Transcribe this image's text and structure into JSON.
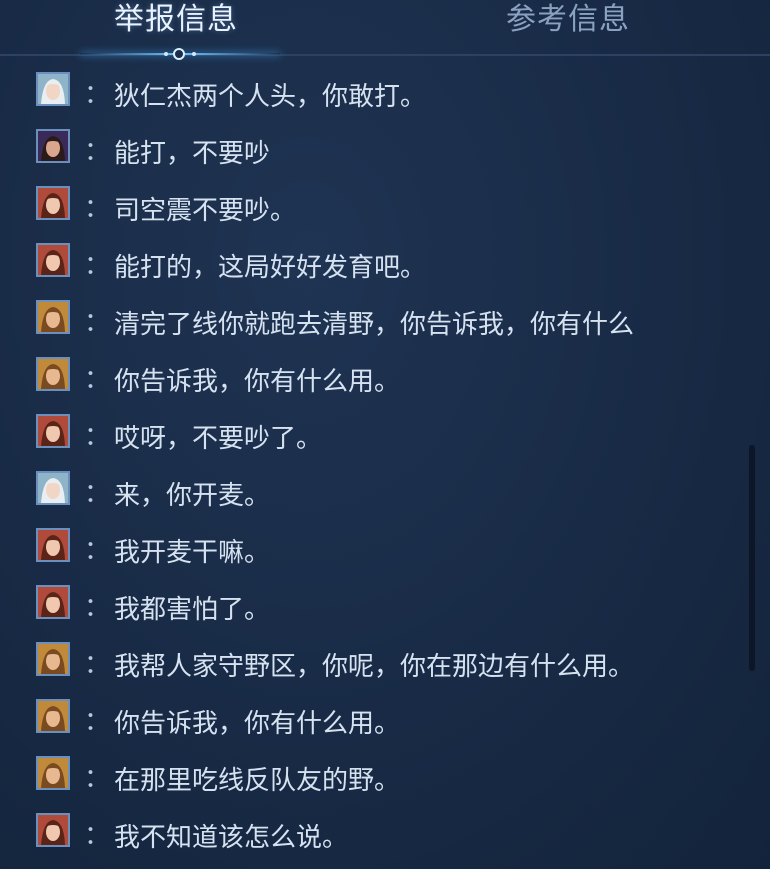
{
  "tabs": {
    "active_label": "举报信息",
    "inactive_label": "参考信息"
  },
  "messages": [
    {
      "avatar": "hero-a-avatar",
      "separator": "：",
      "text": "狄仁杰两个人头，你敢打。"
    },
    {
      "avatar": "hero-b-avatar",
      "separator": "：",
      "text": "能打，不要吵"
    },
    {
      "avatar": "hero-c-avatar",
      "separator": "：",
      "text": "司空震不要吵。"
    },
    {
      "avatar": "hero-c-avatar",
      "separator": "：",
      "text": "能打的，这局好好发育吧。"
    },
    {
      "avatar": "hero-d-avatar",
      "separator": "：",
      "text": "清完了线你就跑去清野，你告诉我，你有什么"
    },
    {
      "avatar": "hero-d-avatar",
      "separator": "：",
      "text": "你告诉我，你有什么用。"
    },
    {
      "avatar": "hero-c-avatar",
      "separator": "：",
      "text": "哎呀，不要吵了。"
    },
    {
      "avatar": "hero-a-avatar",
      "separator": "：",
      "text": "来，你开麦。"
    },
    {
      "avatar": "hero-c-avatar",
      "separator": "：",
      "text": "我开麦干嘛。"
    },
    {
      "avatar": "hero-c-avatar",
      "separator": "：",
      "text": "我都害怕了。"
    },
    {
      "avatar": "hero-d-avatar",
      "separator": "：",
      "text": "我帮人家守野区，你呢，你在那边有什么用。"
    },
    {
      "avatar": "hero-d-avatar",
      "separator": "：",
      "text": "你告诉我，你有什么用。"
    },
    {
      "avatar": "hero-d-avatar",
      "separator": "：",
      "text": "在那里吃线反队友的野。"
    },
    {
      "avatar": "hero-c-avatar",
      "separator": "：",
      "text": "我不知道该怎么说。"
    }
  ],
  "colors": {
    "background": "#182a45",
    "active_tab": "#e9f2ff",
    "inactive_tab": "#8aa2c0",
    "message_text": "#d6e2f0",
    "accent_glow": "#6fc4ff"
  }
}
